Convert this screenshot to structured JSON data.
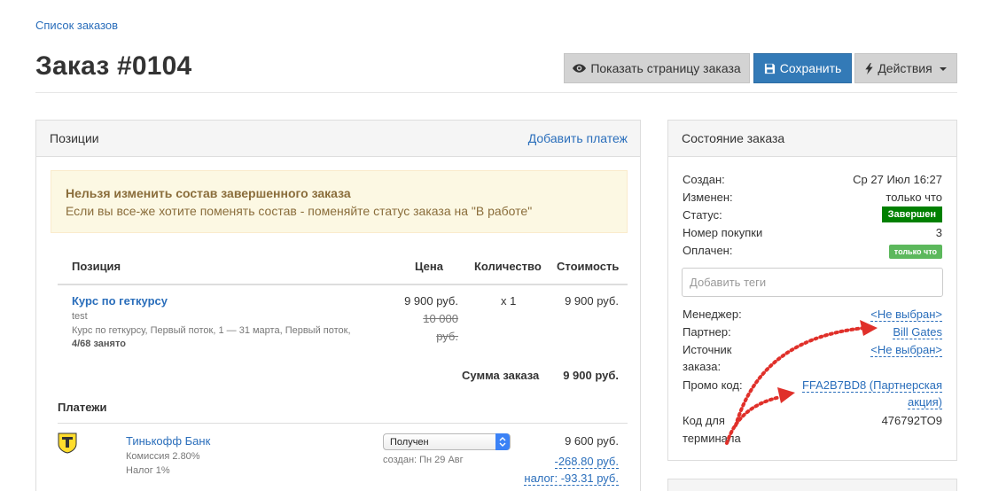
{
  "breadcrumb": "Список заказов",
  "title": "Заказ #0104",
  "toolbar": {
    "show_label": "Показать страницу заказа",
    "save_label": "Сохранить",
    "actions_label": "Действия"
  },
  "positions": {
    "heading": "Позиции",
    "add_payment": "Добавить платеж",
    "alert_title": "Нельзя изменить состав завершенного заказа",
    "alert_text": "Если вы все-же хотите поменять состав - поменяйте статус заказа на \"В работе\"",
    "columns": {
      "item": "Позиция",
      "price": "Цена",
      "qty": "Количество",
      "cost": "Стоимость"
    },
    "item": {
      "name": "Курс по геткурсу",
      "sub": "test",
      "detail": "Курс по геткурсу, Первый поток, 1 — 31 марта, Первый поток,",
      "seats": "4/68 занято",
      "price": "9 900 руб.",
      "old_price_1": "10 000",
      "old_price_2": "руб.",
      "qty": "x 1",
      "cost": "9 900 руб."
    },
    "total_label": "Сумма заказа",
    "total_value": "9 900 руб.",
    "payments_heading": "Платежи",
    "payment": {
      "bank": "Тинькофф Банк",
      "commission": "Комиссия 2.80%",
      "tax": "Налог 1%",
      "status": "Получен",
      "created": "создан: Пн 29 Авг",
      "amount": "9 600 руб.",
      "commission_amount": "-268.80 руб.",
      "tax_amount": "налог: -93.31 руб."
    }
  },
  "state": {
    "heading": "Состояние заказа",
    "created_label": "Создан:",
    "created_value": "Ср 27 Июл 16:27",
    "changed_label": "Изменен:",
    "changed_value": "только что",
    "status_label": "Статус:",
    "status_value": "Завершен",
    "purchase_label": "Номер покупки",
    "purchase_value": "3",
    "paid_label": "Оплачен:",
    "paid_value": "только что",
    "tags_placeholder": "Добавить теги",
    "manager_label": "Менеджер:",
    "manager_value": "<Не выбран>",
    "partner_label": "Партнер:",
    "partner_value": "Bill Gates",
    "source_label_1": "Источник",
    "source_label_2": "заказа:",
    "source_value": "<Не выбран>",
    "promo_label": "Промо код:",
    "promo_value_1": "FFA2B7BD8 (Партнерская",
    "promo_value_2": "акция)",
    "terminal_label_1": "Код для",
    "terminal_label_2": "терминала",
    "terminal_value": "476792TO9"
  },
  "colors": {
    "link": "#2a6ebb",
    "primary": "#337ab7",
    "status_green": "#008000",
    "paid_green": "#5cb85c",
    "annotation_red": "#e0302a"
  }
}
